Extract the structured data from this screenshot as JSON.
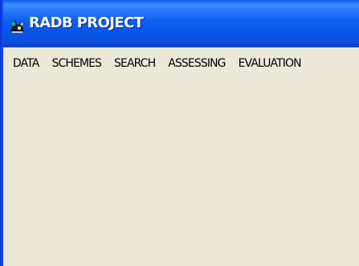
{
  "window": {
    "title": "RADB PROJECT",
    "icon": "radb-app-icon"
  },
  "menubar": {
    "items": [
      {
        "label": "DATA"
      },
      {
        "label": "SCHEMES"
      },
      {
        "label": "SEARCH"
      },
      {
        "label": "ASSESSING"
      },
      {
        "label": "EVALUATION"
      }
    ]
  },
  "colors": {
    "titlebar": "#0855e8",
    "face": "#ece9d8",
    "title_text": "#ffffff"
  }
}
